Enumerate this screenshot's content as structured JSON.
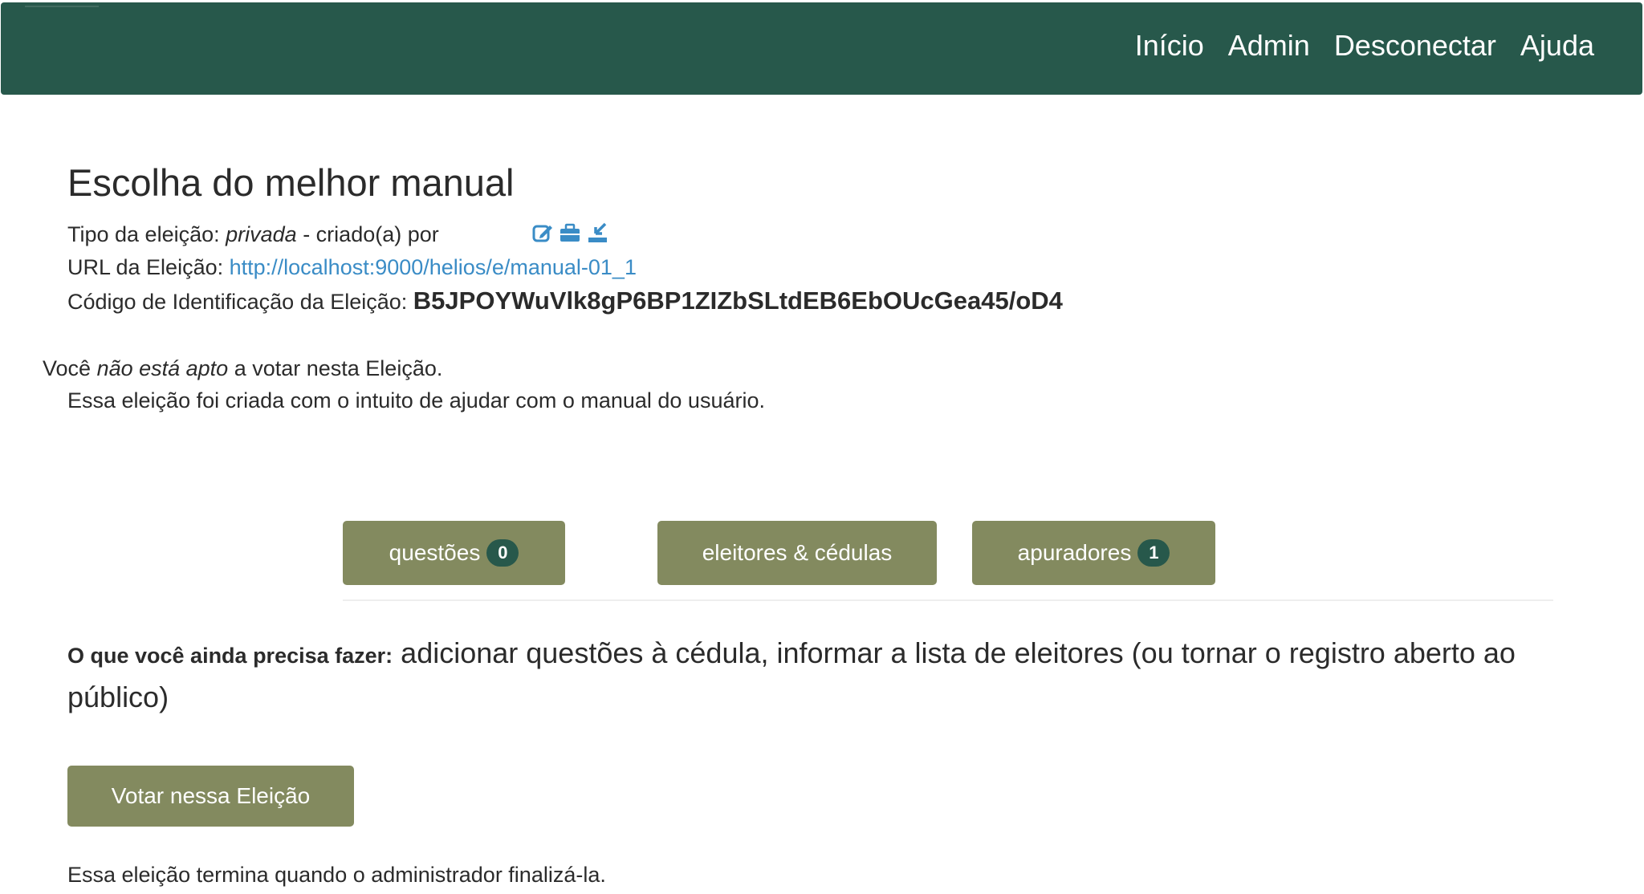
{
  "navbar": {
    "links": [
      "Início",
      "Admin",
      "Desconectar",
      "Ajuda"
    ]
  },
  "election": {
    "title": "Escolha do melhor manual",
    "type_label": "Tipo da eleição: ",
    "type_value": "privada",
    "created_by": " - criado(a) por",
    "url_label": "URL da Eleição: ",
    "url_value": "http://localhost:9000/helios/e/manual-01_1",
    "code_label": "Código de Identificação da Eleição: ",
    "code_value": "B5JPOYWuVlk8gP6BP1ZIZbSLtdEB6EbOUcGea45/oD4",
    "icons": [
      "edit-icon",
      "briefcase-icon",
      "download-icon"
    ]
  },
  "eligibility": {
    "prefix": "Você ",
    "emphasis": "não está apto",
    "suffix": " a votar nesta Eleição."
  },
  "description": "Essa eleição foi criada com o intuito de ajudar com o manual do usuário.",
  "tabs": {
    "questions_label": "questões",
    "questions_count": "0",
    "voters_label": "eleitores & cédulas",
    "trustees_label": "apuradores",
    "trustees_count": "1"
  },
  "todo": {
    "label": "O que você ainda precisa fazer:",
    "text": " adicionar questões à cédula, informar a lista de eleitores (ou tornar o registro aberto ao público)"
  },
  "vote_button": "Votar nessa Eleição",
  "footer": "Essa eleição termina quando o administrador finalizá-la.",
  "colors": {
    "navbar": "#27584b",
    "button": "#838a5f",
    "link": "#3a8cc6",
    "icon": "#3a8cc6"
  }
}
